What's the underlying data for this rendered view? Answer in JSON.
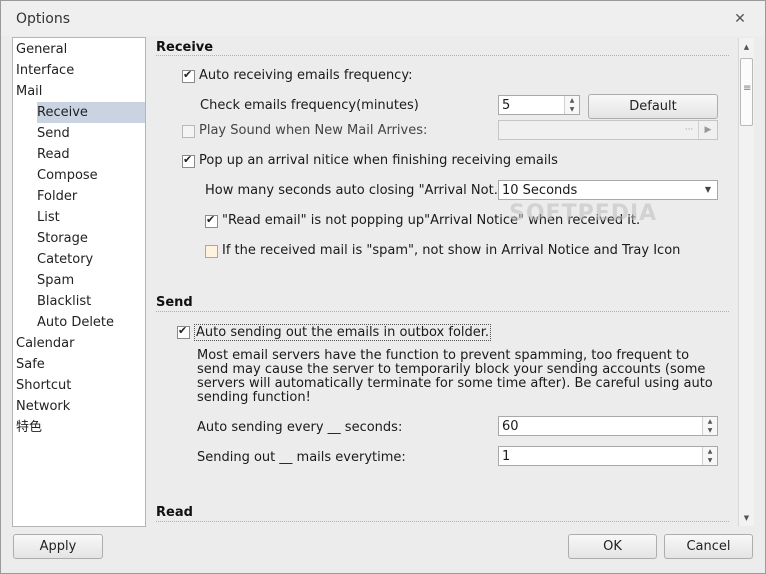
{
  "window": {
    "title": "Options"
  },
  "nav": {
    "items": [
      {
        "label": "General",
        "level": 0
      },
      {
        "label": "Interface",
        "level": 0
      },
      {
        "label": "Mail",
        "level": 0
      },
      {
        "label": "Receive",
        "level": 1,
        "selected": true
      },
      {
        "label": "Send",
        "level": 1
      },
      {
        "label": "Read",
        "level": 1
      },
      {
        "label": "Compose",
        "level": 1
      },
      {
        "label": "Folder",
        "level": 1
      },
      {
        "label": "List",
        "level": 1
      },
      {
        "label": "Storage",
        "level": 1
      },
      {
        "label": "Catetory",
        "level": 1
      },
      {
        "label": "Spam",
        "level": 1
      },
      {
        "label": "Blacklist",
        "level": 1
      },
      {
        "label": "Auto Delete",
        "level": 1
      },
      {
        "label": "Calendar",
        "level": 0
      },
      {
        "label": "Safe",
        "level": 0
      },
      {
        "label": "Shortcut",
        "level": 0
      },
      {
        "label": "Network",
        "level": 0
      },
      {
        "label": "特色",
        "level": 0
      }
    ]
  },
  "receive": {
    "heading": "Receive",
    "auto_receive_label": "Auto receiving emails frequency:",
    "auto_receive_checked": true,
    "frequency_label": "Check emails frequency(minutes)",
    "frequency_value": "5",
    "default_button": "Default",
    "play_sound_label": "Play Sound when New Mail Arrives:",
    "play_sound_checked": false,
    "popup_label": "Pop up an arrival nitice when finishing receiving emails",
    "popup_checked": true,
    "auto_close_label": "How many seconds auto closing \"Arrival Not...",
    "auto_close_value": "10 Seconds",
    "read_email_label": "\"Read email\" is not popping up\"Arrival Notice\" when received it.",
    "read_email_checked": true,
    "spam_label": "If the received mail is \"spam\", not show in  Arrival Notice and Tray Icon",
    "spam_checked": false
  },
  "send": {
    "heading": "Send",
    "auto_send_label": "Auto sending out the emails in outbox folder.",
    "auto_send_checked": true,
    "description": "Most email servers have the function to prevent spamming, too frequent to send may cause the server to temporarily block your sending accounts (some servers will automatically terminate for some time after). Be careful using auto sending function!",
    "auto_send_every_label": "Auto sending every __  seconds:",
    "auto_send_every_value": "60",
    "mails_per_time_label": "Sending out __ mails everytime:",
    "mails_per_time_value": "1"
  },
  "read": {
    "heading": "Read"
  },
  "footer": {
    "apply": "Apply",
    "ok": "OK",
    "cancel": "Cancel"
  },
  "watermark": "SOFTPEDIA"
}
